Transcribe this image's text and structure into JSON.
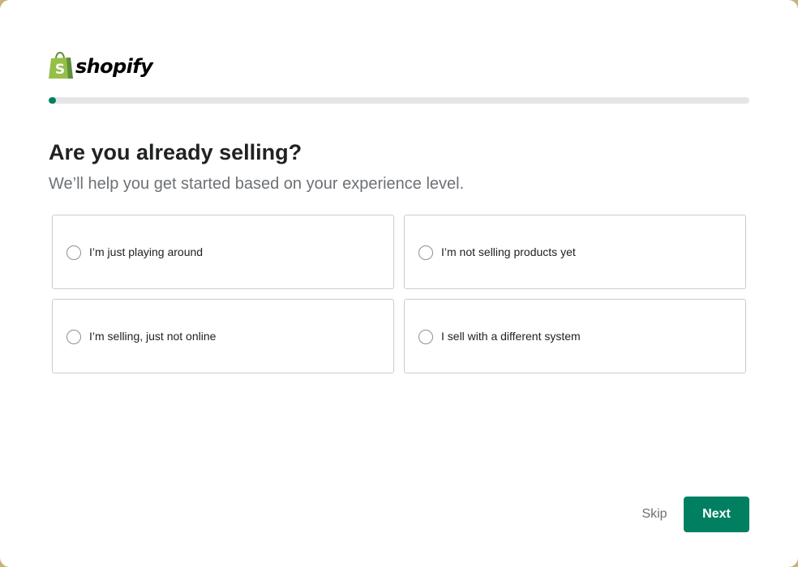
{
  "brand": {
    "name": "shopify",
    "bag_color": "#95bf47",
    "bag_dark_color": "#5e8e3e"
  },
  "progress": {
    "value_percent": 1,
    "color": "#008060"
  },
  "question": {
    "title": "Are you already selling?",
    "subtitle": "We’ll help you get started based on your experience level."
  },
  "options": [
    {
      "label": "I’m just playing around",
      "selected": false
    },
    {
      "label": "I’m not selling products yet",
      "selected": false
    },
    {
      "label": "I’m selling, just not online",
      "selected": false
    },
    {
      "label": "I sell with a different system",
      "selected": false
    }
  ],
  "actions": {
    "skip_label": "Skip",
    "next_label": "Next",
    "primary_color": "#008060"
  }
}
